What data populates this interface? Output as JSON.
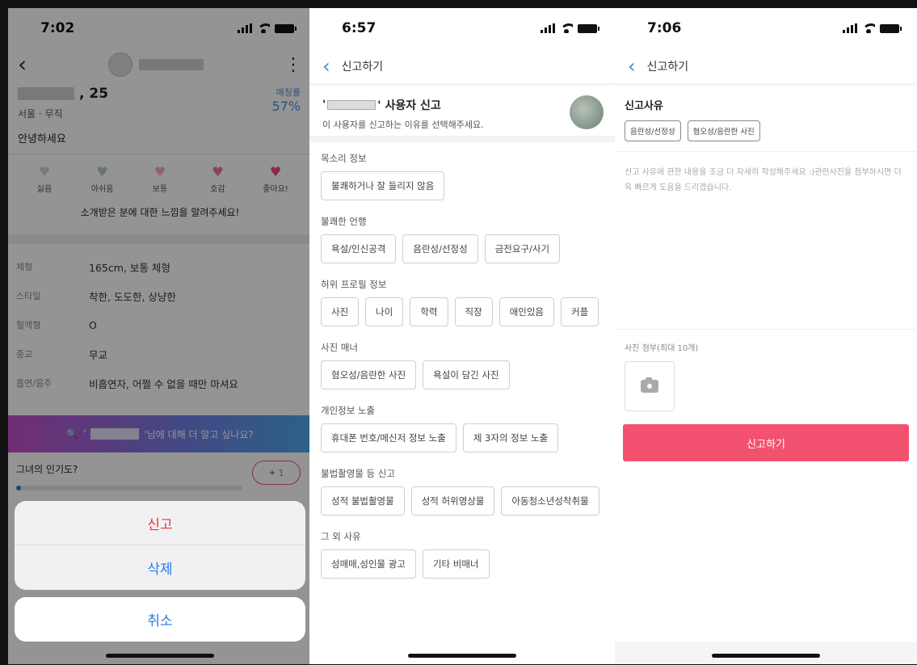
{
  "screen1": {
    "time": "7:02",
    "age": ", 25",
    "location": "서울 · 무직",
    "greeting": "안녕하세요",
    "match_label": "매칭률",
    "match_value": "57%",
    "hearts": [
      {
        "label": "싫음",
        "color": "#cfd3d8"
      },
      {
        "label": "아쉬움",
        "color": "#b4c8c8"
      },
      {
        "label": "보통",
        "color": "#f7a7c0"
      },
      {
        "label": "호감",
        "color": "#f07398"
      },
      {
        "label": "좋아요!",
        "color": "#ec4a78"
      }
    ],
    "hearts_caption": "소개받은 분에 대한 느낌을 알려주세요!",
    "attributes": [
      {
        "key": "체형",
        "value": "165cm, 보통 체형"
      },
      {
        "key": "스타일",
        "value": "착한, 도도한, 상냥한"
      },
      {
        "key": "혈액형",
        "value": "O"
      },
      {
        "key": "종교",
        "value": "무교"
      },
      {
        "key": "흡연/음주",
        "value": "비흡연자, 어쩔 수 없을 때만 마셔요"
      }
    ],
    "banner_prefix": "'",
    "banner_text": "'님에 대해 더 알고 싶나요?",
    "popularity_label": "그녀의 인기도?",
    "popularity_count": "1",
    "sheet": {
      "report": "신고",
      "delete": "삭제",
      "cancel": "취소"
    }
  },
  "screen2": {
    "time": "6:57",
    "nav_title": "신고하기",
    "header_title": "' 사용자 신고",
    "header_subtitle": "이 사용자를 신고하는 이유를 선택해주세요.",
    "sections": [
      {
        "title": "목소리 정보",
        "chips": [
          "불쾌하거나 잘 들리지 않음"
        ]
      },
      {
        "title": "불쾌한 언행",
        "chips": [
          "욕설/인신공격",
          "음란성/선정성",
          "금전요구/사기"
        ]
      },
      {
        "title": "허위 프로필 정보",
        "chips": [
          "사진",
          "나이",
          "학력",
          "직장",
          "애인있음",
          "커플"
        ]
      },
      {
        "title": "사진 매너",
        "chips": [
          "혐오성/음란한 사진",
          "욕설이 담긴 사진"
        ]
      },
      {
        "title": "개인정보 노출",
        "chips": [
          "휴대폰 번호/메신저 정보 노출",
          "제 3자의 정보 노출"
        ]
      },
      {
        "title": "불법촬영물 등 신고",
        "chips": [
          "성적 불법촬영물",
          "성적 허위영상물",
          "아동청소년성착취물"
        ]
      },
      {
        "title": "그 외 사유",
        "chips": [
          "성매매,성인물 광고",
          "기타 비매너"
        ]
      }
    ]
  },
  "screen3": {
    "time": "7:06",
    "nav_title": "신고하기",
    "reason_title": "신고사유",
    "reason_chips": [
      "음란성/선정성",
      "혐오성/음란한 사진"
    ],
    "textarea_placeholder": "신고 사유에 관한 내용을 조금 더 자세히 작성해주세요 :)관련사진을 첨부하시면 더욱 빠르게 도움을 드리겠습니다.",
    "photo_label": "사진 첨부(최대 10개)",
    "submit_label": "신고하기"
  }
}
